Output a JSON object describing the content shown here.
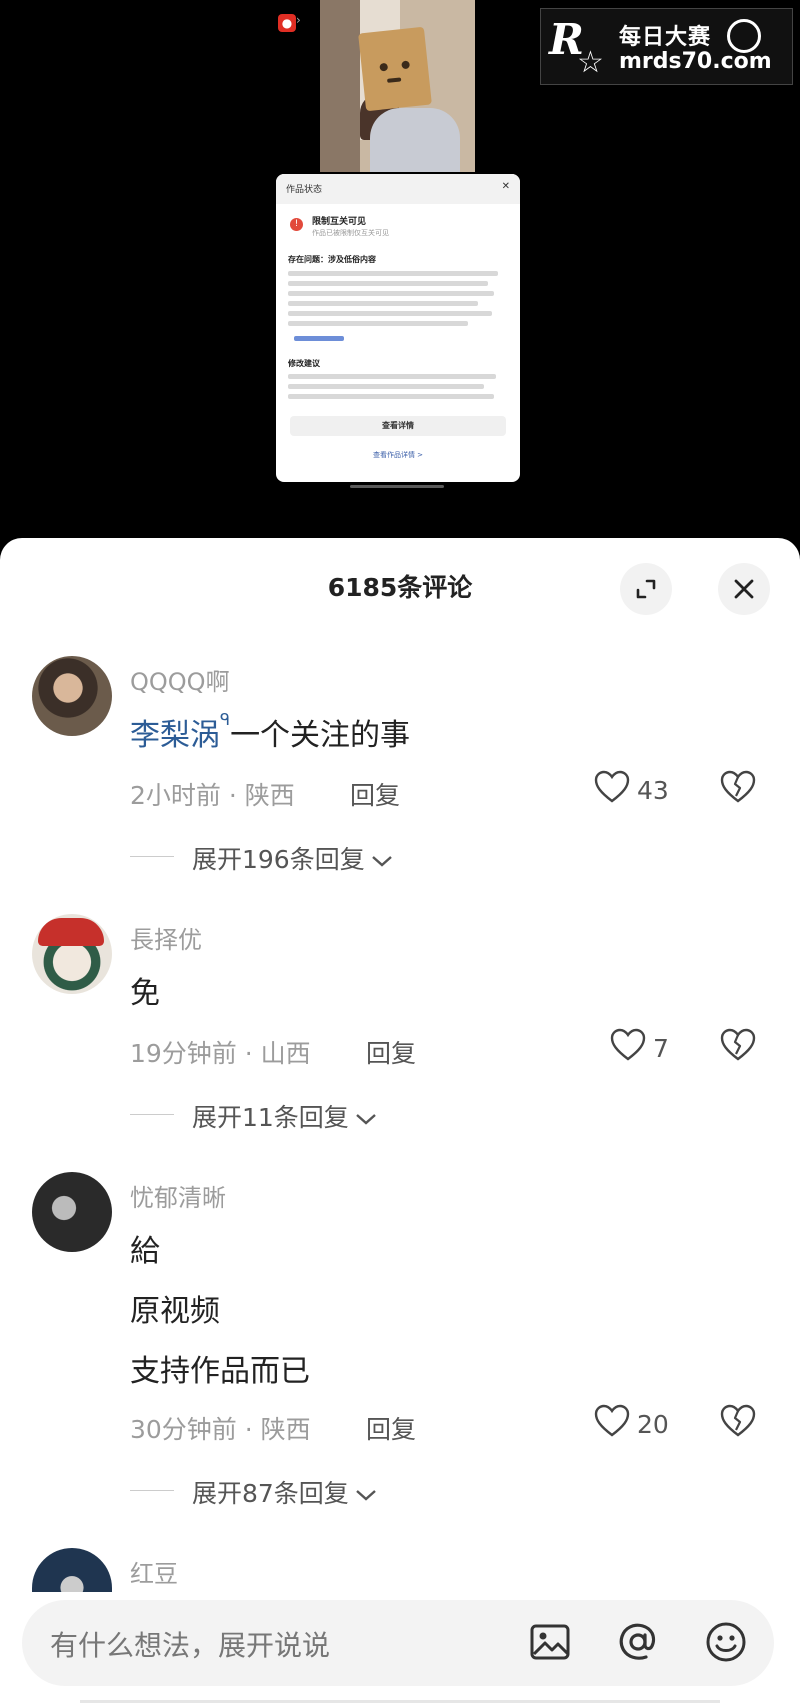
{
  "watermark": {
    "brand_cn": "每日大赛",
    "url": "mrds70.com"
  },
  "video_dialog": {
    "title": "作品状态",
    "alert_title": "限制互关可见",
    "alert_sub": "作品已被限制仅互关可见",
    "section1": "存在问题：涉及低俗内容",
    "section2": "修改建议",
    "button": "查看详情",
    "footer": "查看作品详情 >"
  },
  "comments_panel": {
    "title": "6185条评论",
    "comments": [
      {
        "username": "QQQQ啊",
        "mention": "李梨涡",
        "text_after_mention": "一个关注的事",
        "meta": "2小时前 · 陕西",
        "reply_label": "回复",
        "likes": "43",
        "expand": "展开196条回复"
      },
      {
        "username": "長择优",
        "text": "免",
        "meta": "19分钟前 · 山西",
        "reply_label": "回复",
        "likes": "7",
        "expand": "展开11条回复"
      },
      {
        "username": "忧郁清晰",
        "lines": [
          "給",
          "原视频",
          "支持作品而已"
        ],
        "meta": "30分钟前 · 陕西",
        "reply_label": "回复",
        "likes": "20",
        "expand": "展开87条回复"
      },
      {
        "username": "红豆"
      }
    ]
  },
  "input": {
    "placeholder": "有什么想法，展开说说"
  },
  "icons": {
    "expand": "expand-icon",
    "close": "close-icon",
    "like": "heart-icon",
    "dislike": "broken-heart-icon",
    "image": "image-icon",
    "mention": "at-icon",
    "emoji": "emoji-icon"
  },
  "colors": {
    "mention": "#2c5c96",
    "meta": "#9c9c9c",
    "alert": "#e24a3b"
  }
}
